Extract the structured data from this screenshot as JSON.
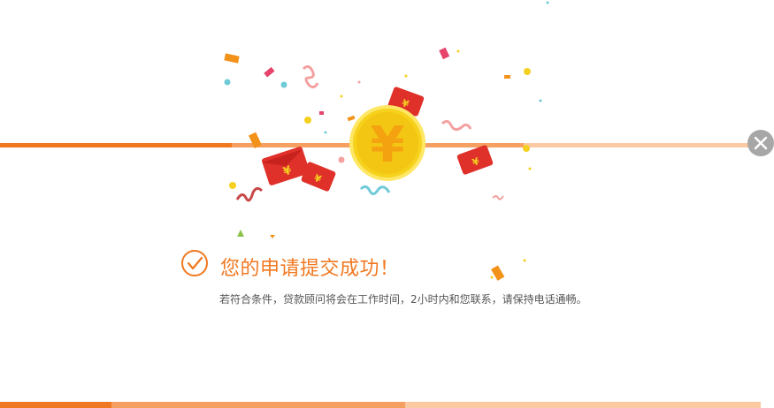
{
  "dialog": {
    "title": "您的申请提交成功！",
    "message": "若符合条件，贷款顾问将会在工作时间，2小时内和您联系，请保持电话通畅。",
    "close_icon": "close-icon",
    "success_icon": "check-circle-icon",
    "coin_symbol": "¥",
    "envelope_symbol": "¥"
  },
  "colors": {
    "accent": "#f07820",
    "accent_mid": "#f5a060",
    "accent_light": "#fbc9a2",
    "close_bg": "#a7a7a7",
    "coin_gold": "#f6d21c",
    "envelope_red": "#e0302a"
  }
}
